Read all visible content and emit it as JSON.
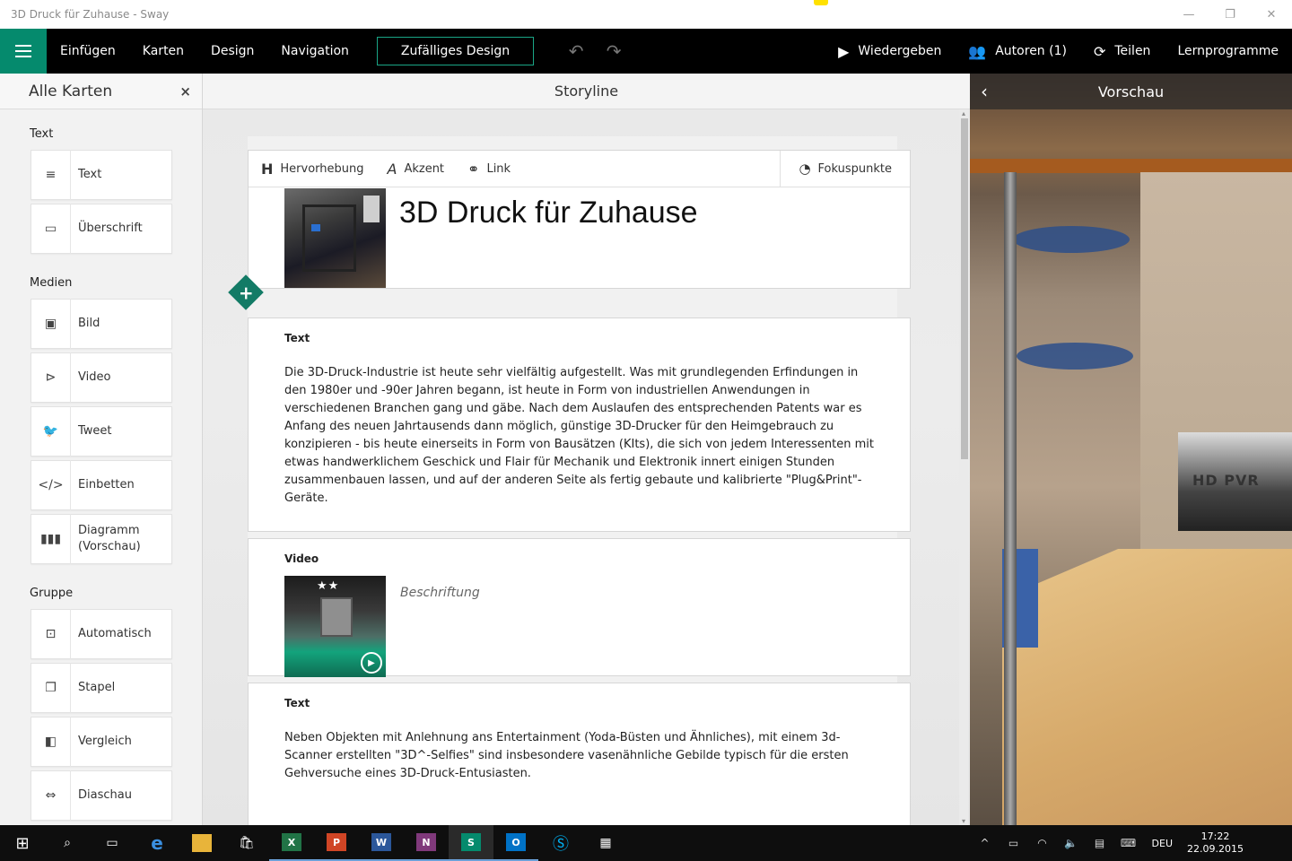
{
  "window": {
    "title": "3D Druck für Zuhause - Sway",
    "controls": [
      "—",
      "❐",
      "✕"
    ]
  },
  "ribbon": {
    "menu": [
      "Einfügen",
      "Karten",
      "Design",
      "Navigation"
    ],
    "random_design": "Zufälliges Design",
    "play": "Wiedergeben",
    "authors": "Autoren (1)",
    "share": "Teilen",
    "tutorials": "Lernprogramme",
    "accent_color": "#058a6d"
  },
  "left_panel": {
    "title": "Alle Karten",
    "close": "×",
    "sections": [
      {
        "name": "Text",
        "items": [
          {
            "label": "Text",
            "icon": "text-lines-icon"
          },
          {
            "label": "Überschrift",
            "icon": "heading-icon"
          }
        ]
      },
      {
        "name": "Medien",
        "items": [
          {
            "label": "Bild",
            "icon": "image-icon"
          },
          {
            "label": "Video",
            "icon": "video-play-icon"
          },
          {
            "label": "Tweet",
            "icon": "twitter-bird-icon"
          },
          {
            "label": "Einbetten",
            "icon": "embed-code-icon"
          },
          {
            "label": "Diagramm (Vorschau)",
            "icon": "bar-chart-icon"
          }
        ]
      },
      {
        "name": "Gruppe",
        "items": [
          {
            "label": "Automatisch",
            "icon": "auto-group-icon"
          },
          {
            "label": "Stapel",
            "icon": "stack-icon"
          },
          {
            "label": "Vergleich",
            "icon": "compare-icon"
          },
          {
            "label": "Diaschau",
            "icon": "slideshow-icon"
          }
        ]
      }
    ]
  },
  "storyline": {
    "header": "Storyline",
    "toolbar": {
      "emphasis": "Hervorhebung",
      "accent": "Akzent",
      "link": "Link",
      "focus_points": "Fokuspunkte"
    },
    "title_card": {
      "title": "3D Druck für Zuhause"
    },
    "text_card_1": {
      "label": "Text",
      "body": "Die 3D-Druck-Industrie ist heute sehr vielfältig aufgestellt. Was mit grundlegenden Erfindungen in den 1980er und -90er Jahren begann, ist heute in Form von industriellen Anwendungen in  verschiedenen Branchen gang und gäbe. Nach dem Auslaufen des entsprechenden Patents war es Anfang des neuen Jahrtausends dann möglich, günstige 3D-Drucker für den Heimgebrauch zu konzipieren - bis heute einerseits in Form von Bausätzen (KIts), die sich von jedem Interessenten mit etwas handwerklichem Geschick und Flair für Mechanik und Elektronik innert einigen Stunden zusammenbauen lassen, und auf der anderen Seite als fertig gebaute und kalibrierte \"Plug&Print\"-Geräte."
    },
    "video_card": {
      "label": "Video",
      "caption_placeholder": "Beschriftung",
      "thumb_stars": "★★"
    },
    "text_card_2": {
      "label": "Text",
      "body": "Neben Objekten mit Anlehnung ans Entertainment (Yoda-Büsten und Ähnliches), mit einem 3d-Scanner erstellten \"3D^-Selfies\" sind insbesondere vasenähnliche Gebilde typisch für die ersten Gehversuche eines 3D-Druck-Entusiasten."
    }
  },
  "preview": {
    "header": "Vorschau",
    "photo_text": "HD PVR"
  },
  "taskbar": {
    "apps": [
      "start-icon",
      "search-icon",
      "task-view-icon",
      "edge-icon",
      "file-explorer-icon",
      "store-icon",
      "excel-icon",
      "powerpoint-icon",
      "word-icon",
      "onenote-icon",
      "sway-icon",
      "outlook-icon",
      "skype-icon",
      "calculator-icon"
    ],
    "tiles": {
      "excel": "X",
      "powerpoint": "P",
      "word": "W",
      "onenote": "N",
      "sway": "S",
      "outlook": "O"
    },
    "language": "DEU",
    "time": "17:22",
    "date": "22.09.2015"
  }
}
